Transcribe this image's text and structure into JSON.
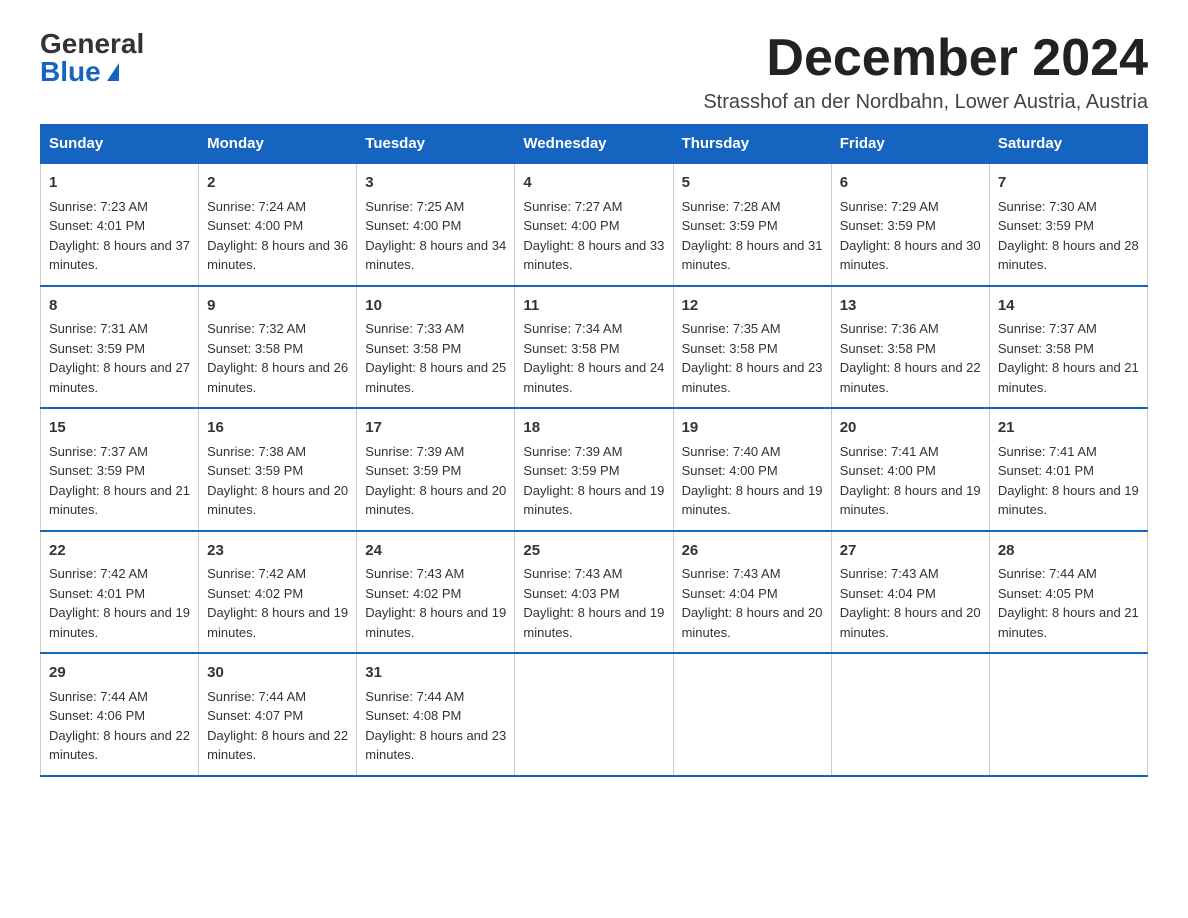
{
  "logo": {
    "general": "General",
    "blue": "Blue"
  },
  "title": "December 2024",
  "location": "Strasshof an der Nordbahn, Lower Austria, Austria",
  "days_header": [
    "Sunday",
    "Monday",
    "Tuesday",
    "Wednesday",
    "Thursday",
    "Friday",
    "Saturday"
  ],
  "weeks": [
    [
      {
        "day": "1",
        "sunrise": "7:23 AM",
        "sunset": "4:01 PM",
        "daylight": "8 hours and 37 minutes."
      },
      {
        "day": "2",
        "sunrise": "7:24 AM",
        "sunset": "4:00 PM",
        "daylight": "8 hours and 36 minutes."
      },
      {
        "day": "3",
        "sunrise": "7:25 AM",
        "sunset": "4:00 PM",
        "daylight": "8 hours and 34 minutes."
      },
      {
        "day": "4",
        "sunrise": "7:27 AM",
        "sunset": "4:00 PM",
        "daylight": "8 hours and 33 minutes."
      },
      {
        "day": "5",
        "sunrise": "7:28 AM",
        "sunset": "3:59 PM",
        "daylight": "8 hours and 31 minutes."
      },
      {
        "day": "6",
        "sunrise": "7:29 AM",
        "sunset": "3:59 PM",
        "daylight": "8 hours and 30 minutes."
      },
      {
        "day": "7",
        "sunrise": "7:30 AM",
        "sunset": "3:59 PM",
        "daylight": "8 hours and 28 minutes."
      }
    ],
    [
      {
        "day": "8",
        "sunrise": "7:31 AM",
        "sunset": "3:59 PM",
        "daylight": "8 hours and 27 minutes."
      },
      {
        "day": "9",
        "sunrise": "7:32 AM",
        "sunset": "3:58 PM",
        "daylight": "8 hours and 26 minutes."
      },
      {
        "day": "10",
        "sunrise": "7:33 AM",
        "sunset": "3:58 PM",
        "daylight": "8 hours and 25 minutes."
      },
      {
        "day": "11",
        "sunrise": "7:34 AM",
        "sunset": "3:58 PM",
        "daylight": "8 hours and 24 minutes."
      },
      {
        "day": "12",
        "sunrise": "7:35 AM",
        "sunset": "3:58 PM",
        "daylight": "8 hours and 23 minutes."
      },
      {
        "day": "13",
        "sunrise": "7:36 AM",
        "sunset": "3:58 PM",
        "daylight": "8 hours and 22 minutes."
      },
      {
        "day": "14",
        "sunrise": "7:37 AM",
        "sunset": "3:58 PM",
        "daylight": "8 hours and 21 minutes."
      }
    ],
    [
      {
        "day": "15",
        "sunrise": "7:37 AM",
        "sunset": "3:59 PM",
        "daylight": "8 hours and 21 minutes."
      },
      {
        "day": "16",
        "sunrise": "7:38 AM",
        "sunset": "3:59 PM",
        "daylight": "8 hours and 20 minutes."
      },
      {
        "day": "17",
        "sunrise": "7:39 AM",
        "sunset": "3:59 PM",
        "daylight": "8 hours and 20 minutes."
      },
      {
        "day": "18",
        "sunrise": "7:39 AM",
        "sunset": "3:59 PM",
        "daylight": "8 hours and 19 minutes."
      },
      {
        "day": "19",
        "sunrise": "7:40 AM",
        "sunset": "4:00 PM",
        "daylight": "8 hours and 19 minutes."
      },
      {
        "day": "20",
        "sunrise": "7:41 AM",
        "sunset": "4:00 PM",
        "daylight": "8 hours and 19 minutes."
      },
      {
        "day": "21",
        "sunrise": "7:41 AM",
        "sunset": "4:01 PM",
        "daylight": "8 hours and 19 minutes."
      }
    ],
    [
      {
        "day": "22",
        "sunrise": "7:42 AM",
        "sunset": "4:01 PM",
        "daylight": "8 hours and 19 minutes."
      },
      {
        "day": "23",
        "sunrise": "7:42 AM",
        "sunset": "4:02 PM",
        "daylight": "8 hours and 19 minutes."
      },
      {
        "day": "24",
        "sunrise": "7:43 AM",
        "sunset": "4:02 PM",
        "daylight": "8 hours and 19 minutes."
      },
      {
        "day": "25",
        "sunrise": "7:43 AM",
        "sunset": "4:03 PM",
        "daylight": "8 hours and 19 minutes."
      },
      {
        "day": "26",
        "sunrise": "7:43 AM",
        "sunset": "4:04 PM",
        "daylight": "8 hours and 20 minutes."
      },
      {
        "day": "27",
        "sunrise": "7:43 AM",
        "sunset": "4:04 PM",
        "daylight": "8 hours and 20 minutes."
      },
      {
        "day": "28",
        "sunrise": "7:44 AM",
        "sunset": "4:05 PM",
        "daylight": "8 hours and 21 minutes."
      }
    ],
    [
      {
        "day": "29",
        "sunrise": "7:44 AM",
        "sunset": "4:06 PM",
        "daylight": "8 hours and 22 minutes."
      },
      {
        "day": "30",
        "sunrise": "7:44 AM",
        "sunset": "4:07 PM",
        "daylight": "8 hours and 22 minutes."
      },
      {
        "day": "31",
        "sunrise": "7:44 AM",
        "sunset": "4:08 PM",
        "daylight": "8 hours and 23 minutes."
      },
      null,
      null,
      null,
      null
    ]
  ]
}
